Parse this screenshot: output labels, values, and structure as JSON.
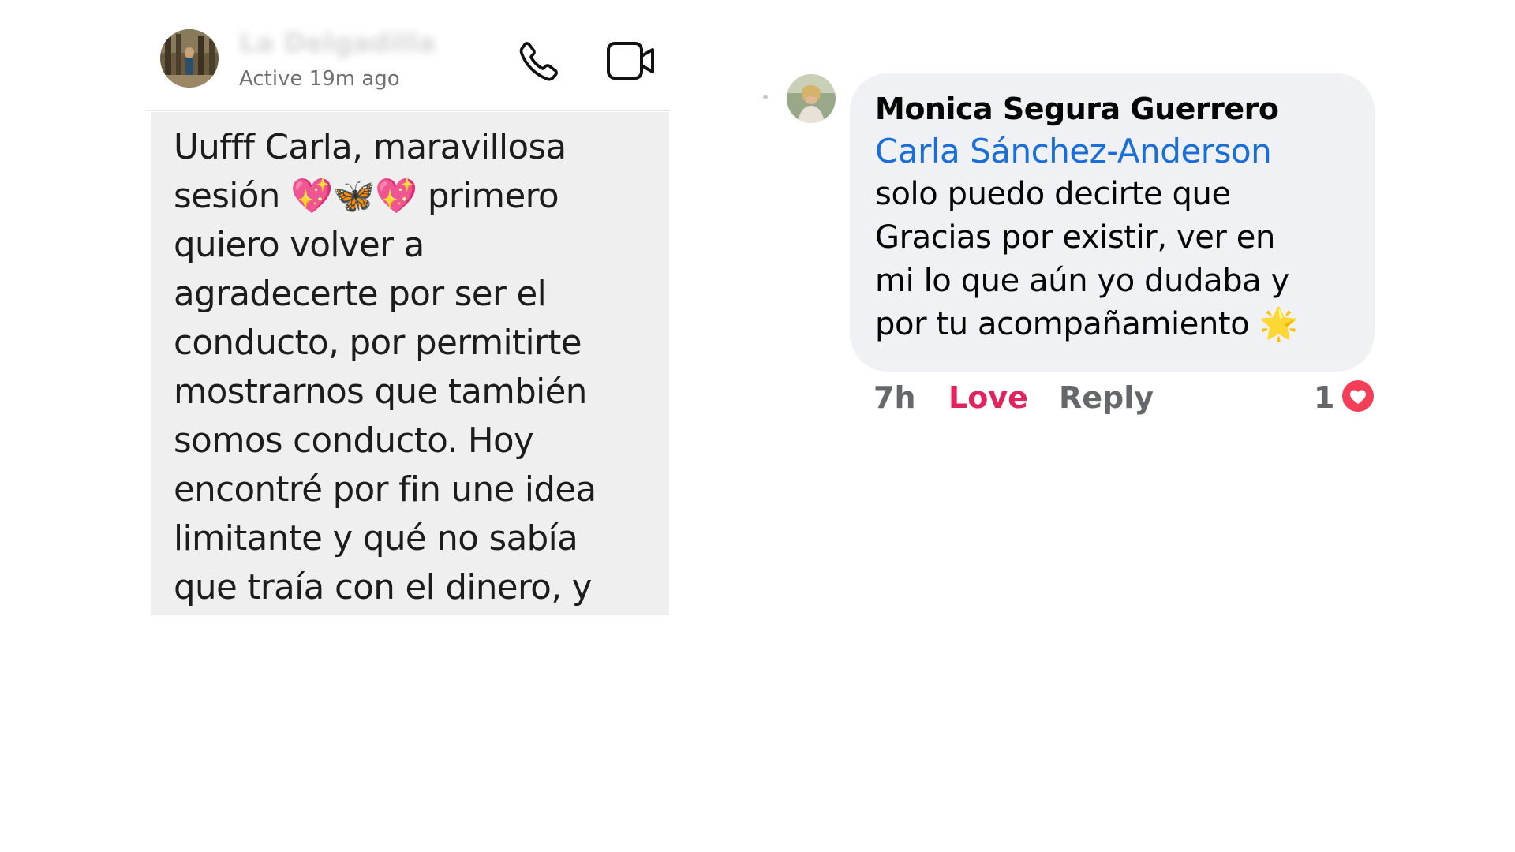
{
  "chat": {
    "contact_name": "La Delgadilla",
    "status": "Active 19m ago",
    "call_icon": "phone-icon",
    "video_icon": "video-camera-icon",
    "message": "Uufff Carla, maravillosa\nsesión 💖🦋💖 primero\nquiero volver a\nagradecerte por ser el\nconducto, por permitirte\nmostrarnos que también\nsomos conducto. Hoy\nencontré por fin une idea\nlimitante y qué no sabía\nque traía con el dinero, y"
  },
  "comment": {
    "author": "Monica Segura Guerrero",
    "mention": "Carla Sánchez-Anderson",
    "text": "solo puedo decirte que\nGracias por existir, ver en\nmi lo que aún yo dudaba y\npor tu acompañamiento",
    "emoji": "🌟",
    "time": "7h",
    "love_label": "Love",
    "reply_label": "Reply",
    "reaction_count": "1",
    "reaction_icon": "heart-icon",
    "colors": {
      "mention": "#1a6ed8",
      "love": "#e0245e",
      "bubble": "#eff1f4"
    }
  }
}
